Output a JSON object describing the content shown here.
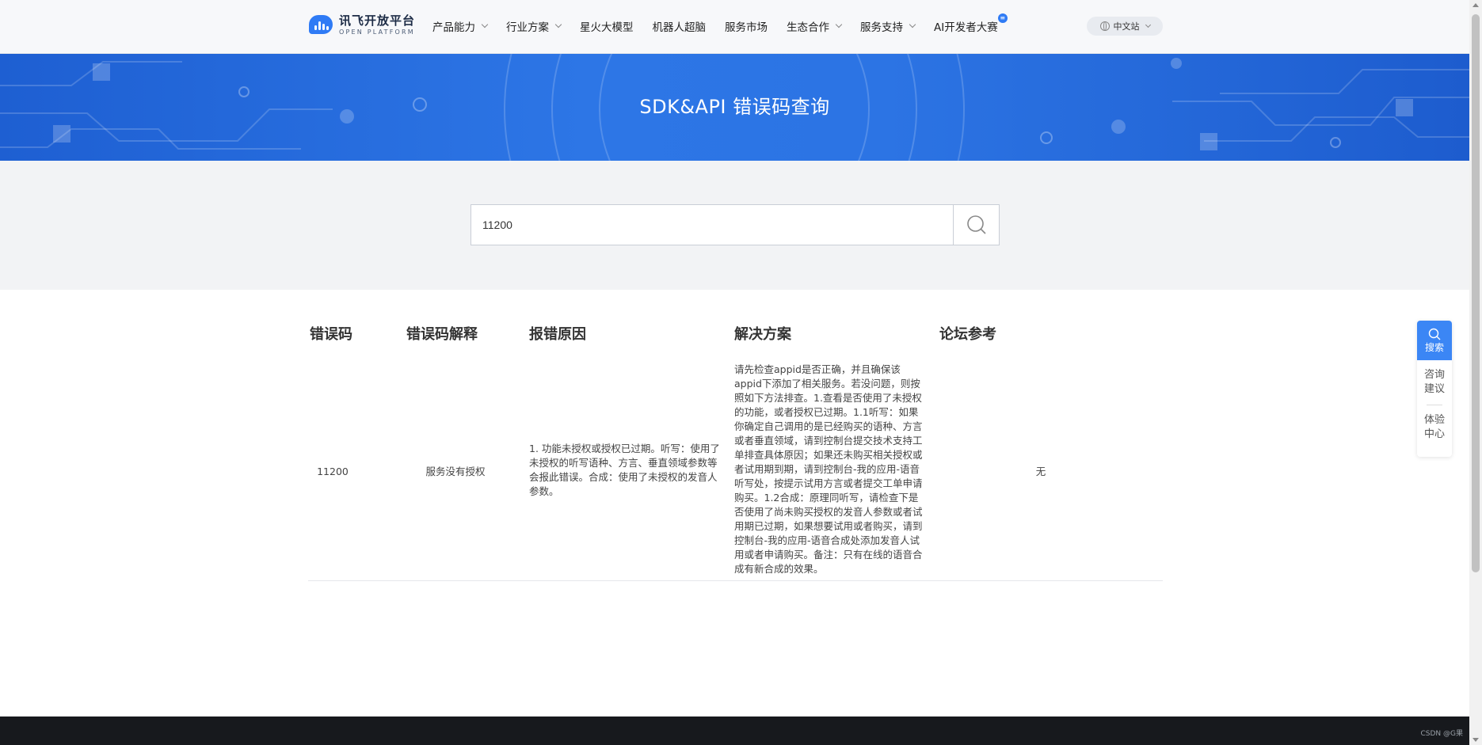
{
  "header": {
    "logo_cn": "讯飞开放平台",
    "logo_en": "OPEN PLATFORM",
    "nav": [
      {
        "label": "产品能力",
        "dropdown": true
      },
      {
        "label": "行业方案",
        "dropdown": true
      },
      {
        "label": "星火大模型",
        "dropdown": false
      },
      {
        "label": "机器人超脑",
        "dropdown": false
      },
      {
        "label": "服务市场",
        "dropdown": false
      },
      {
        "label": "生态合作",
        "dropdown": true
      },
      {
        "label": "服务支持",
        "dropdown": true
      },
      {
        "label": "AI开发者大赛",
        "dropdown": false,
        "badge": true
      }
    ],
    "lang": "中文站"
  },
  "banner": {
    "title": "SDK&API 错误码查询"
  },
  "search": {
    "value": "11200"
  },
  "table": {
    "headers": [
      "错误码",
      "错误码解释",
      "报错原因",
      "解决方案",
      "论坛参考"
    ],
    "rows": [
      {
        "code": "11200",
        "explain": "服务没有授权",
        "reason": "1. 功能未授权或授权已过期。听写：使用了未授权的听写语种、方言、垂直领域参数等会报此错误。合成：使用了未授权的发音人参数。",
        "solution": "请先检查appid是否正确，并且确保该appid下添加了相关服务。若没问题，则按照如下方法排查。1.查看是否使用了未授权的功能，或者授权已过期。1.1听写：如果你确定自己调用的是已经购买的语种、方言或者垂直领域，请到控制台提交技术支持工单排查具体原因；如果还未购买相关授权或者试用期到期，请到控制台-我的应用-语音听写处，按提示试用方言或者提交工单申请购买。1.2合成：原理同听写，请检查下是否使用了尚未购买授权的发音人参数或者试用期已过期，如果想要试用或者购买，请到控制台-我的应用-语音合成处添加发音人试用或者申请购买。备注：只有在线的语音合成有新合成的效果。",
        "forum": "无"
      }
    ]
  },
  "side": {
    "search": "搜索",
    "consult": [
      "咨询",
      "建议"
    ],
    "experience": [
      "体验",
      "中心"
    ]
  },
  "footer": {
    "watermark": "CSDN @G果"
  },
  "colors": {
    "brand": "#2f7bf5",
    "banner": "#2a6fe0",
    "footer": "#17191d"
  }
}
